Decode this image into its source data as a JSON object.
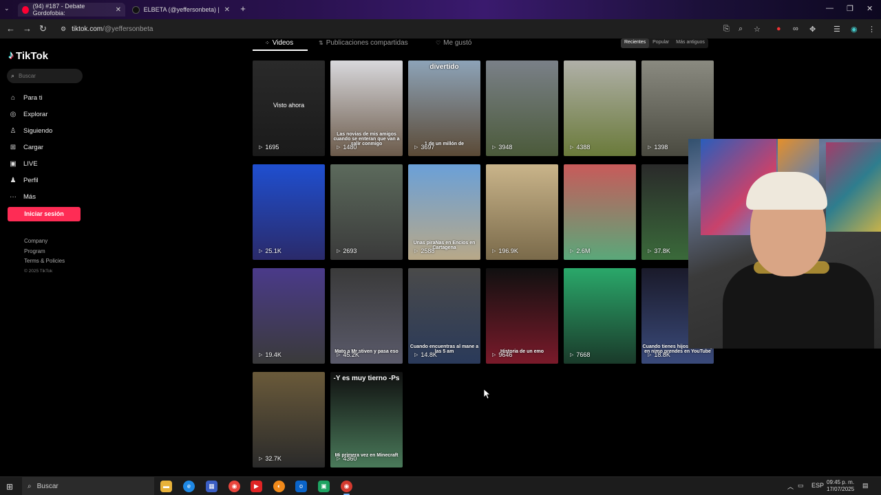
{
  "browser": {
    "tabs": [
      {
        "title": "(94) #187 - Debate Gordofobia:",
        "favicon_color": "#ff0033",
        "active": true
      },
      {
        "title": "ELBETA (@yeffersonbeta) | TikTok",
        "favicon_color": "#111111",
        "active": false
      }
    ],
    "new_tab": "+",
    "url_host": "tiktok.com",
    "url_path": "/@yeffersonbeta"
  },
  "tiktok": {
    "logo_text": "TikTok",
    "search_placeholder": "Buscar",
    "nav": [
      {
        "label": "Para ti",
        "icon": "home-icon"
      },
      {
        "label": "Explorar",
        "icon": "compass-icon"
      },
      {
        "label": "Siguiendo",
        "icon": "following-icon"
      },
      {
        "label": "Cargar",
        "icon": "upload-icon"
      },
      {
        "label": "LIVE",
        "icon": "live-icon"
      },
      {
        "label": "Perfil",
        "icon": "profile-icon"
      },
      {
        "label": "Más",
        "icon": "more-icon"
      }
    ],
    "login_button": "Iniciar sesión",
    "footer": {
      "company": "Company",
      "program": "Program",
      "terms": "Terms & Policies",
      "copyright": "© 2025 TikTok"
    },
    "profile_tabs": [
      "Videos",
      "Publicaciones compartidas",
      "Me gustó"
    ],
    "sort_options": [
      "Recientes",
      "Popular",
      "Más antiguos"
    ],
    "videos": [
      {
        "views": "1695",
        "overlay": "Visto ahora",
        "caption": "",
        "color1": "#2a2a2a",
        "color2": "#1a1a1a"
      },
      {
        "views": "1480",
        "overlay": "",
        "caption": "Las novias de mis amigos cuando se enteran que van a salir conmigo",
        "color1": "#d8d8dc",
        "color2": "#6b5a4a"
      },
      {
        "views": "3697",
        "overlay": "",
        "caption_top": "divertido",
        "caption": "1 de un millón de",
        "color1": "#8da3b8",
        "color2": "#5b4a36"
      },
      {
        "views": "3948",
        "overlay": "",
        "caption": "",
        "color1": "#7a8088",
        "color2": "#4b5a3a"
      },
      {
        "views": "4388",
        "overlay": "",
        "caption": "",
        "color1": "#b0b0a8",
        "color2": "#6a7a3a"
      },
      {
        "views": "1398",
        "overlay": "",
        "caption": "",
        "color1": "#8a8a80",
        "color2": "#4a4a40"
      },
      {
        "views": "25.1K",
        "overlay": "",
        "caption": "",
        "color1": "#1f4fd0",
        "color2": "#2a2a6a"
      },
      {
        "views": "2693",
        "overlay": "",
        "caption": "",
        "color1": "#5c6a5c",
        "color2": "#3a3a3a"
      },
      {
        "views": "2588",
        "overlay": "",
        "caption": "Unas piraNas en Encios en Cartagena",
        "color1": "#6aa0d8",
        "color2": "#b8a888"
      },
      {
        "views": "196.9K",
        "overlay": "",
        "caption": "",
        "color1": "#c9b48a",
        "color2": "#7a6a4a"
      },
      {
        "views": "2.6M",
        "overlay": "",
        "caption": "",
        "color1": "#c85a5a",
        "color2": "#5aa87a"
      },
      {
        "views": "37.8K",
        "overlay": "",
        "caption": "",
        "color1": "#2a2a2a",
        "color2": "#3a6a3a"
      },
      {
        "views": "19.4K",
        "overlay": "",
        "caption": "",
        "color1": "#4a3a8a",
        "color2": "#3a3a3a"
      },
      {
        "views": "45.2K",
        "overlay": "",
        "caption": "Mato a Mr stiven y pasa eso",
        "color1": "#3a3a3a",
        "color2": "#5a5a6a"
      },
      {
        "views": "14.8K",
        "overlay": "",
        "caption": "Cuando encuentras al mane a las 5 am",
        "color1": "#4a4a4a",
        "color2": "#2a3a5a"
      },
      {
        "views": "9646",
        "overlay": "",
        "caption": "Historia de un emo",
        "color1": "#101010",
        "color2": "#7a1a2a"
      },
      {
        "views": "7668",
        "overlay": "",
        "caption": "",
        "color1": "#2aa86a",
        "color2": "#1a3a2a"
      },
      {
        "views": "18.8K",
        "overlay": "",
        "caption": "Cuando tienes hijos streaming en nimo prendes en YouTube",
        "color1": "#1a1a2a",
        "color2": "#3a4a7a"
      },
      {
        "views": "32.7K",
        "overlay": "",
        "caption": "",
        "color1": "#6a5a3a",
        "color2": "#2a2a2a"
      },
      {
        "views": "4360",
        "overlay": "",
        "caption_top": "-Y es muy tierno -Ps",
        "caption": "Mi primera vez en Minecraft",
        "color1": "#101010",
        "color2": "#4a7a5a"
      }
    ]
  },
  "taskbar": {
    "search_placeholder": "Buscar",
    "language": "ESP",
    "time": "09:45 p. m.",
    "date": "17/07/2025"
  }
}
